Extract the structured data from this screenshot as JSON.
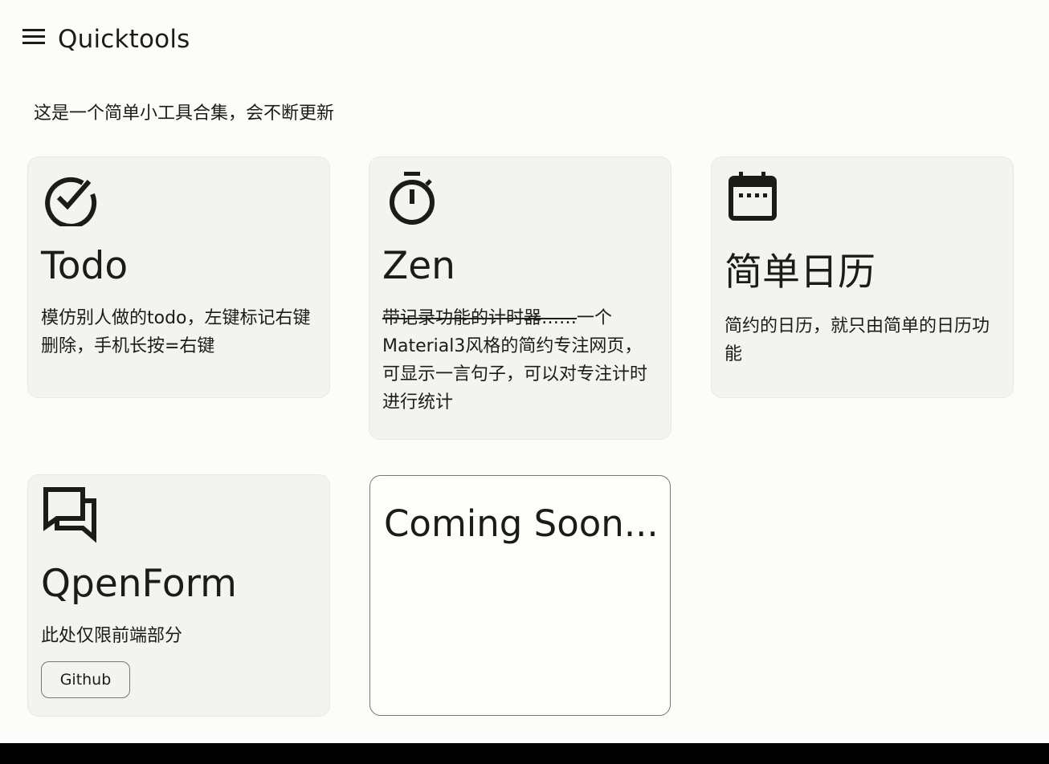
{
  "header": {
    "title": "Quicktools",
    "menu_icon": "menu-icon"
  },
  "intro": "这是一个简单小工具合集，会不断更新",
  "cards": [
    {
      "icon": "check-circle-icon",
      "title": "Todo",
      "description": "模仿别人做的todo，左键标记右键删除，手机长按=右键"
    },
    {
      "icon": "stopwatch-icon",
      "title": "Zen",
      "description_struck": "带记录功能的计时器……",
      "description": "一个Material3风格的简约专注网页，可显示一言句子，可以对专注计时进行统计"
    },
    {
      "icon": "calendar-icon",
      "title": "简单日历",
      "description": "简约的日历，就只由简单的日历功能"
    },
    {
      "icon": "forum-icon",
      "title": "QpenForm",
      "description": "此处仅限前端部分",
      "button_label": "Github"
    },
    {
      "title": "Coming Soon..."
    }
  ],
  "colors": {
    "background": "#fcfcfa",
    "card_surface": "#f3f3f0",
    "text": "#1d1b16",
    "outline": "#7b776d"
  }
}
